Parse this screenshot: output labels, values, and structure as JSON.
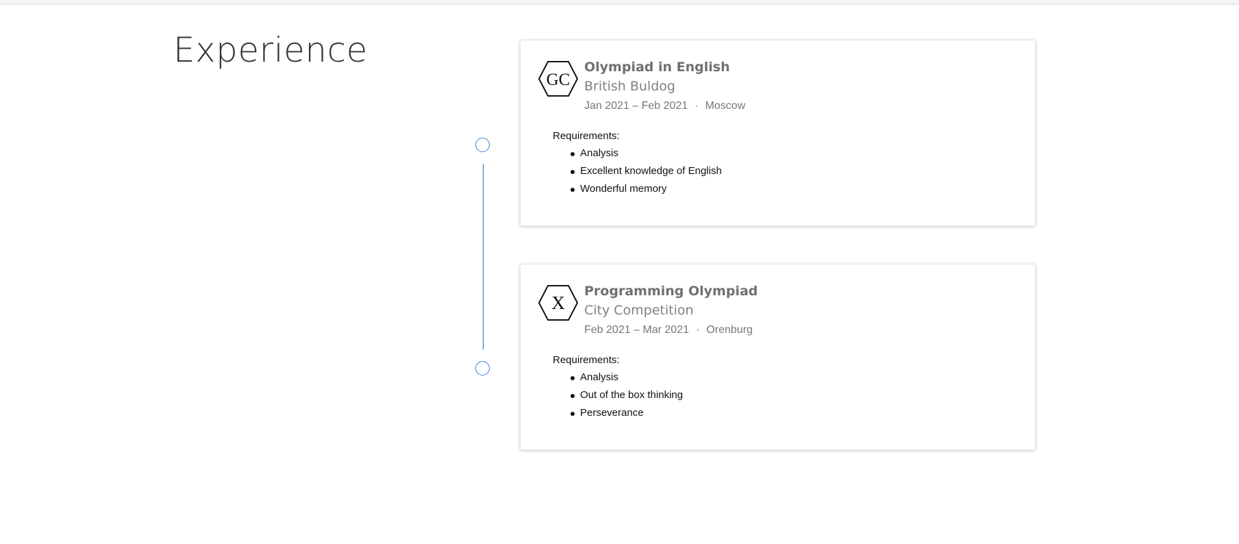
{
  "section": {
    "title": "Experience"
  },
  "experiences": [
    {
      "logo_text": "GC",
      "title": "Olympiad in English",
      "organization": "British Buldog",
      "dates": "Jan 2021 – Feb 2021",
      "separator": "·",
      "location": "Moscow",
      "requirements_label": "Requirements:",
      "requirements": [
        "Analysis",
        "Excellent knowledge of English",
        "Wonderful memory"
      ]
    },
    {
      "logo_text": "X",
      "title": "Programming Olympiad",
      "organization": "City Competition",
      "dates": "Feb 2021 – Mar 2021",
      "separator": "·",
      "location": "Orenburg",
      "requirements_label": "Requirements:",
      "requirements": [
        "Analysis",
        "Out of the box thinking",
        "Perseverance"
      ]
    }
  ],
  "colors": {
    "timeline_accent": "#3d7fd1",
    "timeline_line": "#1f6fb4",
    "title_text": "#707070"
  },
  "icons": {
    "logo_shape": "hexagon-logo-icon",
    "timeline_marker": "circle-marker-icon"
  }
}
